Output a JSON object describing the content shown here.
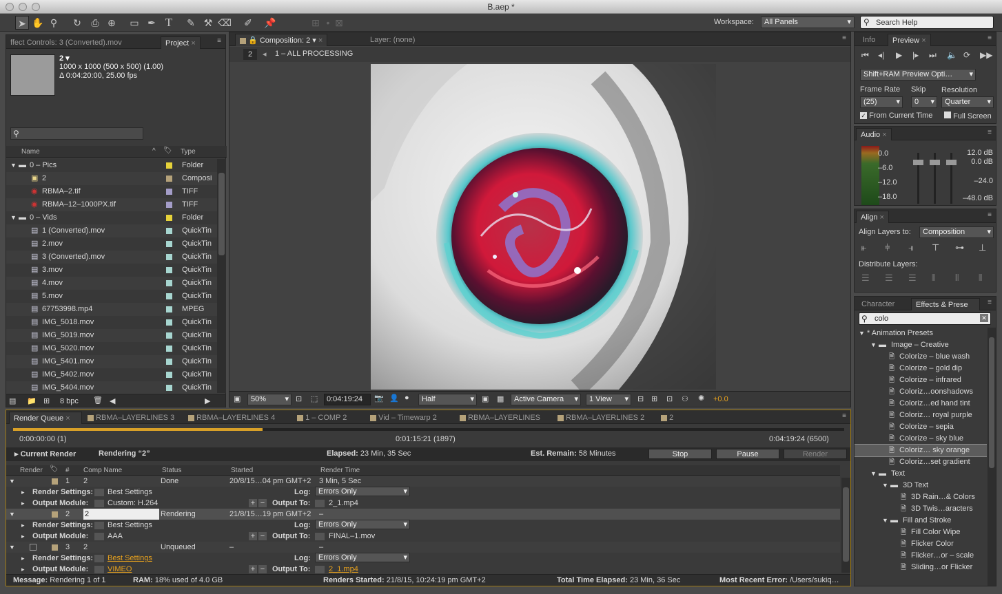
{
  "window": {
    "title": "B.aep *"
  },
  "toolbar": {
    "workspace_label": "Workspace:",
    "workspace_value": "All Panels",
    "search_help_placeholder": "Search Help"
  },
  "project_panel": {
    "tabs": [
      "ffect Controls: 3 (Converted).mov",
      "Project"
    ],
    "active_tab": "Project",
    "comp_name": "2 ▾",
    "comp_size": "1000 x 1000  (500 x 500) (1.00)",
    "comp_duration": "Δ 0:04:20:00, 25.00 fps",
    "col_name": "Name",
    "col_type": "Type",
    "items": [
      {
        "name": "0 – Pics",
        "type": "Folder",
        "color": "#e6d23a",
        "indent": 0,
        "kind": "folder",
        "open": true
      },
      {
        "name": "2",
        "type": "Composi",
        "color": "#b5a27a",
        "indent": 1,
        "kind": "comp"
      },
      {
        "name": "RBMA–2.tif",
        "type": "TIFF",
        "color": "#a49dc8",
        "indent": 1,
        "kind": "image"
      },
      {
        "name": "RBMA–12–1000PX.tif",
        "type": "TIFF",
        "color": "#a49dc8",
        "indent": 1,
        "kind": "image"
      },
      {
        "name": "0 – Vids",
        "type": "Folder",
        "color": "#e6d23a",
        "indent": 0,
        "kind": "folder",
        "open": true
      },
      {
        "name": "1 (Converted).mov",
        "type": "QuickTin",
        "color": "#a7d6d0",
        "indent": 1,
        "kind": "file"
      },
      {
        "name": "2.mov",
        "type": "QuickTin",
        "color": "#a7d6d0",
        "indent": 1,
        "kind": "file"
      },
      {
        "name": "3 (Converted).mov",
        "type": "QuickTin",
        "color": "#a7d6d0",
        "indent": 1,
        "kind": "file"
      },
      {
        "name": "3.mov",
        "type": "QuickTin",
        "color": "#a7d6d0",
        "indent": 1,
        "kind": "file"
      },
      {
        "name": "4.mov",
        "type": "QuickTin",
        "color": "#a7d6d0",
        "indent": 1,
        "kind": "file"
      },
      {
        "name": "5.mov",
        "type": "QuickTin",
        "color": "#a7d6d0",
        "indent": 1,
        "kind": "file"
      },
      {
        "name": "67753998.mp4",
        "type": "MPEG",
        "color": "#a7d6d0",
        "indent": 1,
        "kind": "file"
      },
      {
        "name": "IMG_5018.mov",
        "type": "QuickTin",
        "color": "#a7d6d0",
        "indent": 1,
        "kind": "file"
      },
      {
        "name": "IMG_5019.mov",
        "type": "QuickTin",
        "color": "#a7d6d0",
        "indent": 1,
        "kind": "file"
      },
      {
        "name": "IMG_5020.mov",
        "type": "QuickTin",
        "color": "#a7d6d0",
        "indent": 1,
        "kind": "file"
      },
      {
        "name": "IMG_5401.mov",
        "type": "QuickTin",
        "color": "#a7d6d0",
        "indent": 1,
        "kind": "file"
      },
      {
        "name": "IMG_5402.mov",
        "type": "QuickTin",
        "color": "#a7d6d0",
        "indent": 1,
        "kind": "file"
      },
      {
        "name": "IMG_5404.mov",
        "type": "QuickTin",
        "color": "#a7d6d0",
        "indent": 1,
        "kind": "file"
      }
    ],
    "bpc": "8 bpc"
  },
  "composition_panel": {
    "tab_label": "Composition: 2",
    "layer_tab": "Layer: (none)",
    "nav_num": "2",
    "breadcrumb": "1 – ALL PROCESSING",
    "zoom": "50%",
    "timecode": "0:04:19:24",
    "resolution": "Half",
    "camera": "Active Camera",
    "views": "1 View",
    "exposure": "+0.0"
  },
  "info_preview": {
    "tabs": [
      "Info",
      "Preview"
    ],
    "active_tab": "Preview",
    "ram_preview": "Shift+RAM Preview Opti…",
    "frame_rate_label": "Frame Rate",
    "skip_label": "Skip",
    "resolution_label": "Resolution",
    "frame_rate_value": "(25)",
    "skip_value": "0",
    "resolution_value": "Quarter",
    "from_current_time": "From Current Time",
    "full_screen": "Full Screen"
  },
  "audio_panel": {
    "tab": "Audio",
    "left_labels": [
      "0.0",
      "–6.0",
      "–12.0",
      "–18.0"
    ],
    "right_labels": [
      "12.0 dB",
      "0.0 dB",
      "–24.0",
      "–48.0 dB"
    ]
  },
  "align_panel": {
    "tab": "Align",
    "align_to_label": "Align Layers to:",
    "align_to_value": "Composition",
    "distribute_label": "Distribute Layers:"
  },
  "effects_panel": {
    "tabs": [
      "Character",
      "Effects & Prese"
    ],
    "active_tab": "Effects & Prese",
    "search_value": "colo",
    "items": [
      {
        "label": "* Animation Presets",
        "indent": 0,
        "kind": "folder"
      },
      {
        "label": "Image – Creative",
        "indent": 1,
        "kind": "folder"
      },
      {
        "label": "Colorize – blue wash",
        "indent": 2,
        "kind": "preset"
      },
      {
        "label": "Colorize – gold dip",
        "indent": 2,
        "kind": "preset"
      },
      {
        "label": "Colorize – infrared",
        "indent": 2,
        "kind": "preset"
      },
      {
        "label": "Coloriz…oonshadows",
        "indent": 2,
        "kind": "preset"
      },
      {
        "label": "Coloriz…ed hand tint",
        "indent": 2,
        "kind": "preset"
      },
      {
        "label": "Coloriz… royal purple",
        "indent": 2,
        "kind": "preset"
      },
      {
        "label": "Colorize – sepia",
        "indent": 2,
        "kind": "preset"
      },
      {
        "label": "Colorize – sky blue",
        "indent": 2,
        "kind": "preset"
      },
      {
        "label": "Coloriz… sky orange",
        "indent": 2,
        "kind": "preset",
        "selected": true
      },
      {
        "label": "Coloriz…set gradient",
        "indent": 2,
        "kind": "preset"
      },
      {
        "label": "Text",
        "indent": 1,
        "kind": "folder"
      },
      {
        "label": "3D Text",
        "indent": 2,
        "kind": "folder"
      },
      {
        "label": "3D Rain…& Colors",
        "indent": 3,
        "kind": "preset"
      },
      {
        "label": "3D Twis…aracters",
        "indent": 3,
        "kind": "preset"
      },
      {
        "label": "Fill and Stroke",
        "indent": 2,
        "kind": "folder"
      },
      {
        "label": "Fill Color Wipe",
        "indent": 3,
        "kind": "preset"
      },
      {
        "label": "Flicker Color",
        "indent": 3,
        "kind": "preset"
      },
      {
        "label": "Flicker…or – scale",
        "indent": 3,
        "kind": "preset"
      },
      {
        "label": "Sliding…or Flicker",
        "indent": 3,
        "kind": "preset"
      }
    ]
  },
  "render_queue": {
    "tabs": [
      "Render Queue",
      "RBMA–LAYERLINES 3",
      "RBMA–LAYERLINES 4",
      "1 – COMP 2",
      "Vid – Timewarp 2",
      "RBMA–LAYERLINES",
      "RBMA–LAYERLINES 2",
      "2"
    ],
    "progress": 0.3,
    "time_start": "0:00:00:00 (1)",
    "time_mid": "0:01:15:21 (1897)",
    "time_end": "0:04:19:24 (6500)",
    "current_render_label": "Current Render",
    "rendering_label": "Rendering “2”",
    "elapsed_label": "Elapsed:",
    "elapsed_value": "23 Min, 35 Sec",
    "remain_label": "Est. Remain:",
    "remain_value": "58 Minutes",
    "stop_label": "Stop",
    "pause_label": "Pause",
    "render_label": "Render",
    "columns": [
      "Render",
      "#",
      "Comp Name",
      "Status",
      "Started",
      "Render Time"
    ],
    "rows": [
      {
        "num": "1",
        "comp": "2",
        "status": "Done",
        "started": "20/8/15…04 pm GMT+2",
        "time": "3 Min, 5 Sec",
        "render_settings": "Best Settings",
        "log": "Errors Only",
        "output_module": "Custom: H.264",
        "output_to": "2_1.mp4",
        "highlight": false
      },
      {
        "num": "2",
        "comp": "2",
        "status": "Rendering",
        "started": "21/8/15…19 pm GMT+2",
        "time": "–",
        "render_settings": "Best Settings",
        "log": "Errors Only",
        "output_module": "AAA",
        "output_to": "FINAL–1.mov",
        "highlight": false
      },
      {
        "num": "3",
        "comp": "2",
        "status": "Unqueued",
        "started": "–",
        "time": "–",
        "render_settings": "Best Settings",
        "log": "Errors Only",
        "output_module": "VIMEO",
        "output_to": "2_1.mp4",
        "highlight": true
      }
    ],
    "labels": {
      "render_settings": "Render Settings:",
      "output_module": "Output Module:",
      "log": "Log:",
      "output_to": "Output To:"
    },
    "status_bar": {
      "message_label": "Message:",
      "message": "Rendering 1 of 1",
      "ram_label": "RAM:",
      "ram": "18% used of 4.0 GB",
      "started_label": "Renders Started:",
      "started": "21/8/15, 10:24:19 pm GMT+2",
      "total_label": "Total Time Elapsed:",
      "total": "23 Min, 36 Sec",
      "error_label": "Most Recent Error:",
      "error": "/Users/sukiq…"
    }
  }
}
